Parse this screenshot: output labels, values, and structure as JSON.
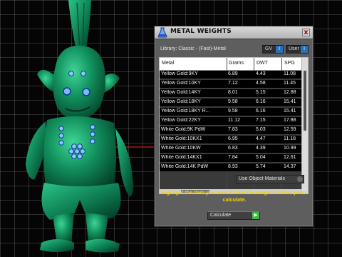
{
  "window": {
    "title": "METAL WEIGHTS",
    "title_icon": "flask-icon",
    "close_label": "x"
  },
  "library": {
    "label": "Library: Classic - (Fast)-Metal"
  },
  "unit_selects": {
    "gv": "GV",
    "user": "User"
  },
  "table": {
    "columns": [
      "Metal",
      "Grams",
      "DWT",
      "SPG"
    ],
    "rows": [
      {
        "metal": "Yellow Gold:9KY",
        "grams": "6.89",
        "dwt": "4.43",
        "spg": "11.08"
      },
      {
        "metal": "Yellow Gold:10KY",
        "grams": "7.12",
        "dwt": "4.58",
        "spg": "11.45"
      },
      {
        "metal": "Yellow Gold:14KY",
        "grams": "8.01",
        "dwt": "5.15",
        "spg": "12.88"
      },
      {
        "metal": "Yellow Gold:18KY",
        "grams": "9.58",
        "dwt": "6.16",
        "spg": "15.41"
      },
      {
        "metal": "Yellow Gold:18KY R...",
        "grams": "9.58",
        "dwt": "6.16",
        "spg": "15.41"
      },
      {
        "metal": "Yellow Gold:22KY",
        "grams": "11.12",
        "dwt": "7.15",
        "spg": "17.88"
      },
      {
        "metal": "White Gold:9K PdW",
        "grams": "7.83",
        "dwt": "5.03",
        "spg": "12.59"
      },
      {
        "metal": "White Gold:10KX1",
        "grams": "6.95",
        "dwt": "4.47",
        "spg": "11.18"
      },
      {
        "metal": "White Gold:10KW",
        "grams": "6.83",
        "dwt": "4.39",
        "spg": "10.99"
      },
      {
        "metal": "White Gold:14KX1",
        "grams": "7.84",
        "dwt": "5.04",
        "spg": "12.61"
      },
      {
        "metal": "White Gold:14K PdW",
        "grams": "8.93",
        "dwt": "5.74",
        "spg": "14.37"
      }
    ]
  },
  "options": {
    "use_object_materials": "Use Object Materials"
  },
  "instructions": "Highlight the item you want to find the weight for then press calculate.",
  "calculate_label": "Calculate",
  "colors": {
    "figure": "#0f8a5a",
    "instruction_text": "#f3d000",
    "accent_blue": "#2a72b8",
    "accent_green": "#3db843"
  }
}
